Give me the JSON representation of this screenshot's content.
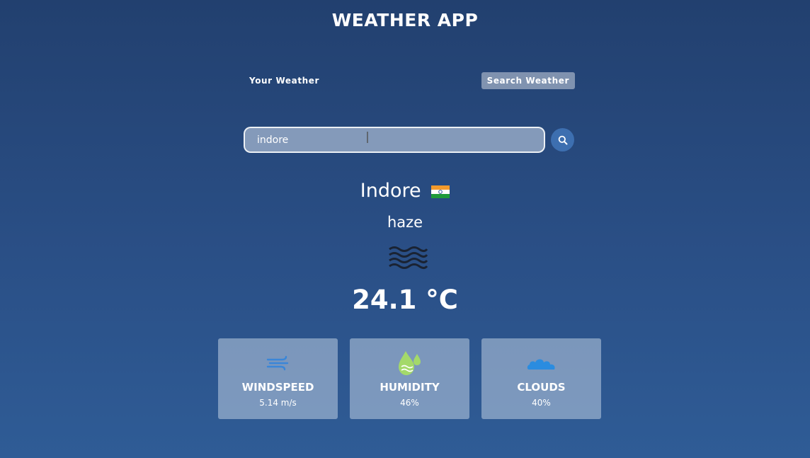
{
  "app": {
    "title": "WEATHER APP"
  },
  "tabs": [
    {
      "label": "Your Weather",
      "active": false
    },
    {
      "label": "Search Weather",
      "active": true
    }
  ],
  "search": {
    "value": "indore",
    "button_icon": "search-icon"
  },
  "weather": {
    "city": "Indore",
    "flag_icon": "india-flag-icon",
    "description": "haze",
    "condition_icon": "haze-icon",
    "temperature": "24.1 °C"
  },
  "stats": [
    {
      "label": "WINDSPEED",
      "value": "5.14 m/s",
      "icon": "wind-icon"
    },
    {
      "label": "HUMIDITY",
      "value": "46%",
      "icon": "humidity-icon"
    },
    {
      "label": "CLOUDS",
      "value": "40%",
      "icon": "cloud-icon"
    }
  ],
  "colors": {
    "background": "#2a4f86",
    "accent_button": "#3d6fb0",
    "wind_icon": "#3a86d8",
    "humidity_icon": "#a4d96a",
    "cloud_icon": "#2a8ce0"
  }
}
